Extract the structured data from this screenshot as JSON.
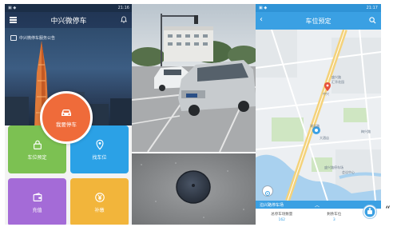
{
  "left_app": {
    "status_time": "21:16",
    "title": "中兴微停车",
    "notice": "中兴微停车服务公告",
    "center_button": "我要停车",
    "tiles": [
      "车位预定",
      "找车位",
      "充值",
      "补缴"
    ],
    "colors": {
      "header": "#213655",
      "center": "#ef6b3a",
      "reserve": "#7cc152",
      "find": "#2ba1e6",
      "topup": "#a46bd7",
      "pay": "#f2b53b"
    },
    "icons": [
      "menu-icon",
      "bell-icon",
      "car-icon",
      "lock-icon",
      "location-icon",
      "wallet-icon",
      "yuan-icon"
    ]
  },
  "right_app": {
    "status_time": "21:17",
    "title": "车位预定",
    "map_labels": [
      "盛兴路",
      "汇华花园",
      "中兴",
      "湖北路",
      "梅兴路",
      "大酒店",
      "会议中心",
      "盛兴路停车场"
    ],
    "bottom_bar": "泊兴路停车场",
    "stats": [
      {
        "label": "总停车场数量",
        "value": "162"
      },
      {
        "label": "剩余车位",
        "value": "3"
      }
    ],
    "accent": "#3aa0e3",
    "icons": [
      "back-icon",
      "search-icon",
      "map-pin-icon",
      "locate-icon",
      "chevron-up-icon",
      "parking-icon"
    ]
  },
  "trailing_mark": "“"
}
